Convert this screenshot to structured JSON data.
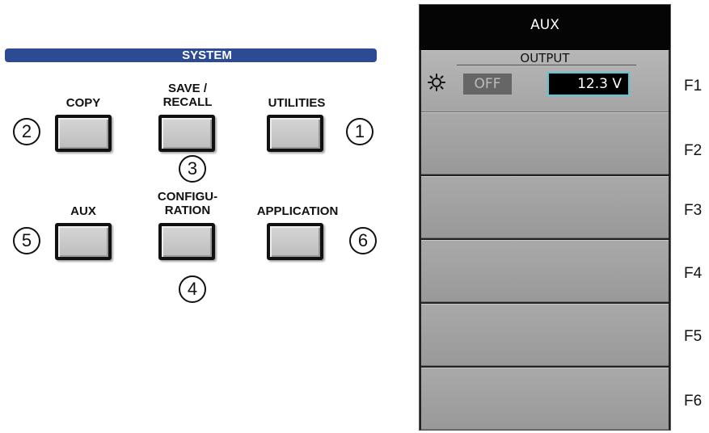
{
  "system_panel": {
    "title": "SYSTEM",
    "keys": [
      {
        "label_line1": "COPY",
        "label_line2": "",
        "callout": "2"
      },
      {
        "label_line1": "SAVE /",
        "label_line2": "RECALL",
        "callout": "3"
      },
      {
        "label_line1": "UTILITIES",
        "label_line2": "",
        "callout": "1"
      },
      {
        "label_line1": "AUX",
        "label_line2": "",
        "callout": "5"
      },
      {
        "label_line1": "CONFIGU-",
        "label_line2": "RATION",
        "callout": "4"
      },
      {
        "label_line1": "APPLICATION",
        "label_line2": "",
        "callout": "6"
      }
    ]
  },
  "aux_menu": {
    "title": "AUX",
    "output": {
      "title": "OUTPUT",
      "icon": "sun-icon",
      "toggle_label": "OFF",
      "value": "12.3 V",
      "value_border_color": "#58c8d8"
    }
  },
  "function_keys": [
    "F1",
    "F2",
    "F3",
    "F4",
    "F5",
    "F6"
  ]
}
